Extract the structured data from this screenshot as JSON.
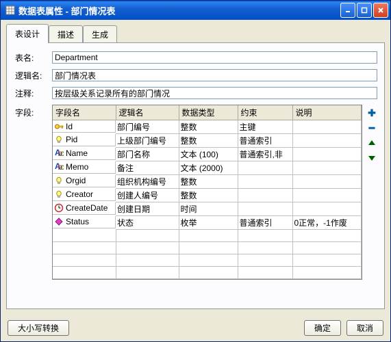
{
  "title": "数据表属性 - 部门情况表",
  "tabs": {
    "design": "表设计",
    "desc": "描述",
    "gen": "生成"
  },
  "labels": {
    "tableName": "表名:",
    "logicalName": "逻辑名:",
    "note": "注释:",
    "fields": "字段:"
  },
  "values": {
    "tableName": "Department",
    "logicalName": "部门情况表",
    "note": "按层级关系记录所有的部门情况"
  },
  "columns": {
    "name": "字段名",
    "logic": "逻辑名",
    "dtype": "数据类型",
    "constraint": "约束",
    "desc": "说明"
  },
  "rows": [
    {
      "icon": "key",
      "name": "Id",
      "logic": "部门编号",
      "dtype": "整数",
      "constraint": "主键",
      "desc": ""
    },
    {
      "icon": "bulb",
      "name": "Pid",
      "logic": "上级部门编号",
      "dtype": "整数",
      "constraint": "普通索引",
      "desc": ""
    },
    {
      "icon": "abc",
      "name": "Name",
      "logic": "部门名称",
      "dtype": "文本 (100)",
      "constraint": "普通索引,非",
      "desc": ""
    },
    {
      "icon": "abc",
      "name": "Memo",
      "logic": "备注",
      "dtype": "文本 (2000)",
      "constraint": "",
      "desc": ""
    },
    {
      "icon": "bulb",
      "name": "Orgid",
      "logic": "组织机构编号",
      "dtype": "整数",
      "constraint": "",
      "desc": ""
    },
    {
      "icon": "bulb",
      "name": "Creator",
      "logic": "创建人编号",
      "dtype": "整数",
      "constraint": "",
      "desc": ""
    },
    {
      "icon": "clock",
      "name": "CreateDate",
      "logic": "创建日期",
      "dtype": "时间",
      "constraint": "",
      "desc": ""
    },
    {
      "icon": "diamond",
      "name": "Status",
      "logic": "状态",
      "dtype": "枚举",
      "constraint": "普通索引",
      "desc": "0正常，-1作废"
    }
  ],
  "buttons": {
    "caseToggle": "大小写转换",
    "ok": "确定",
    "cancel": "取消"
  }
}
